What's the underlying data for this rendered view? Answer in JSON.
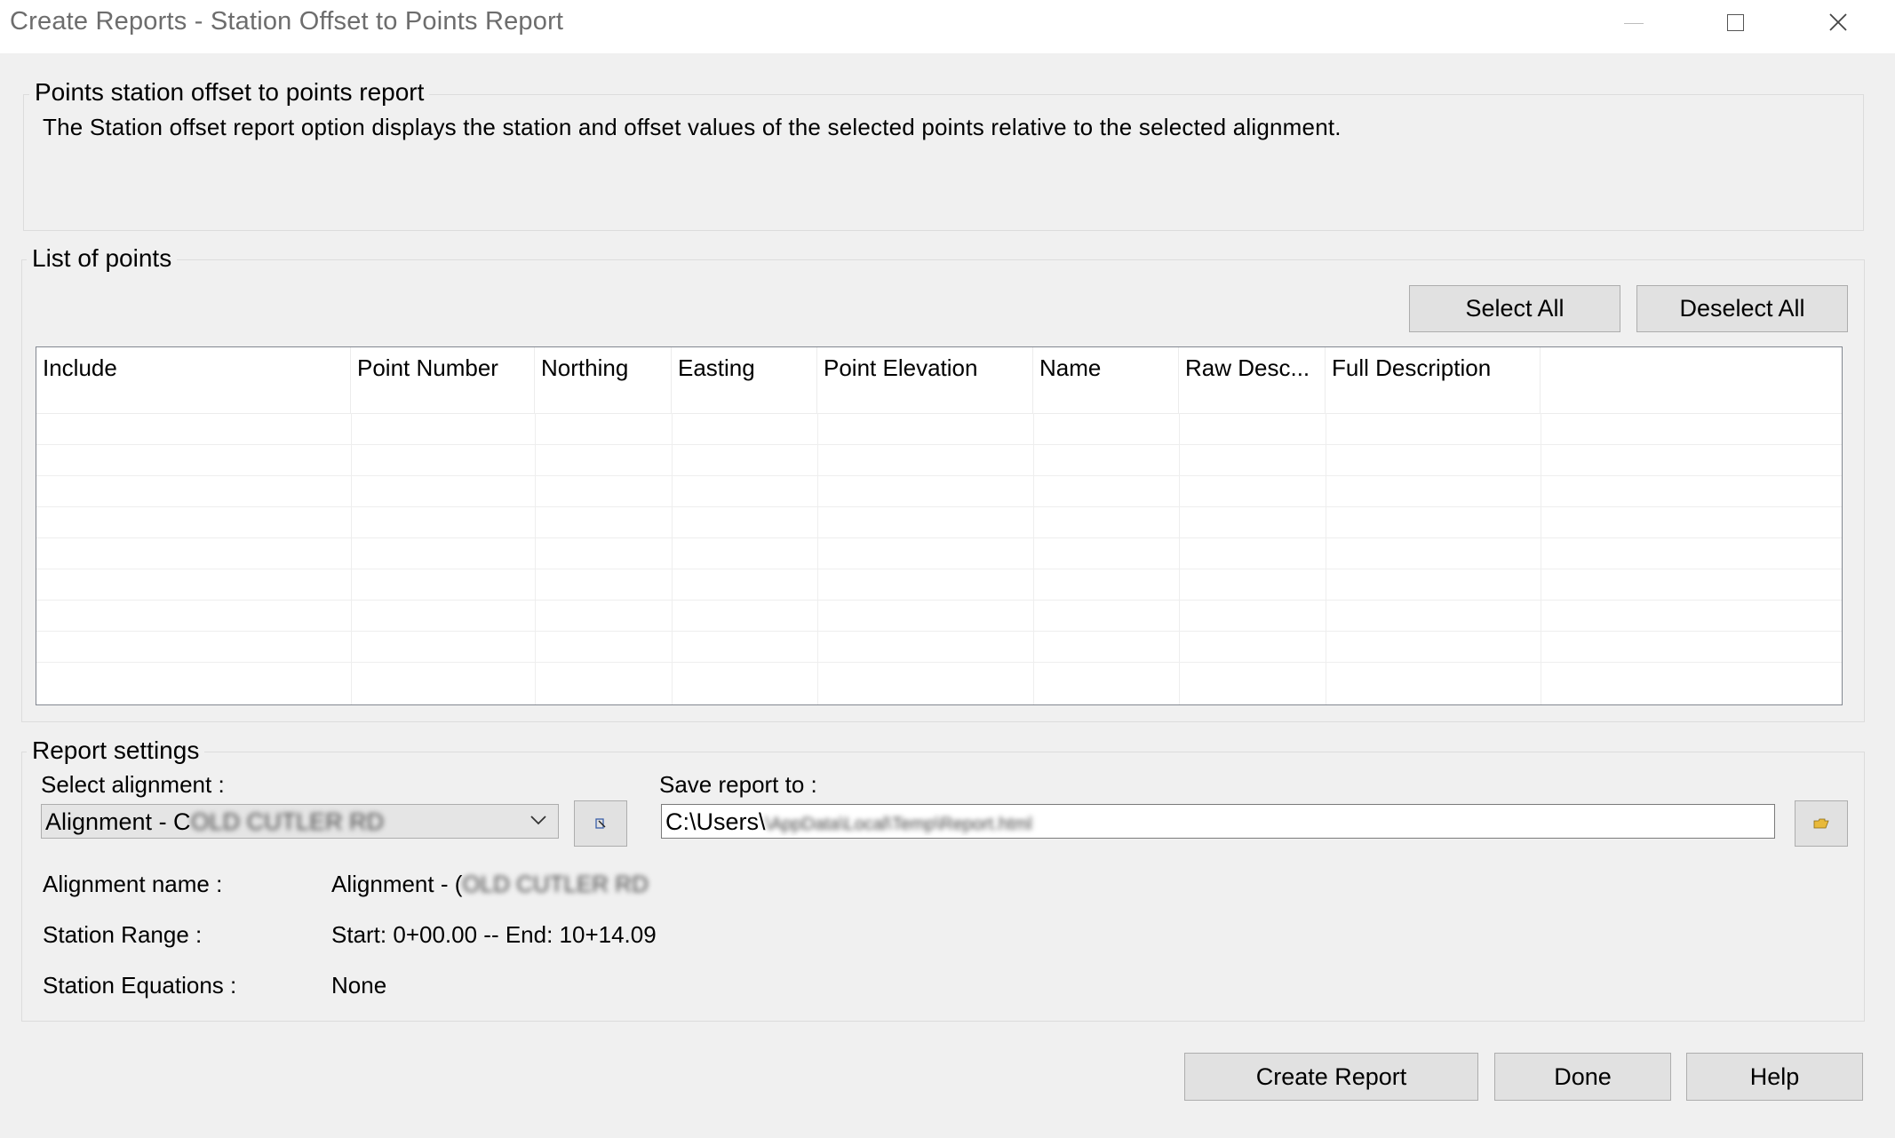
{
  "window": {
    "title": "Create Reports - Station Offset to Points Report"
  },
  "description_group": {
    "title": "Points station offset to points report",
    "text": "The Station offset report option displays the station and offset values of the selected points relative to the selected alignment."
  },
  "points_group": {
    "title": "List of points",
    "select_all_label": "Select All",
    "deselect_all_label": "Deselect All",
    "columns": [
      "Include",
      "Point Number",
      "Northing",
      "Easting",
      "Point Elevation",
      "Name",
      "Raw Desc...",
      "Full Description",
      ""
    ],
    "rows": []
  },
  "report_settings": {
    "title": "Report settings",
    "select_alignment_label": "Select alignment :",
    "selected_alignment_visible": "Alignment - C",
    "selected_alignment_obscured": "OLD CUTLER RD",
    "save_report_label": "Save report to :",
    "save_path_visible": "C:\\Users\\",
    "save_path_obscured": "\\AppData\\Local\\Temp\\Report.html",
    "alignment_name_label": "Alignment name :",
    "alignment_name_visible": "Alignment - (",
    "alignment_name_obscured": "OLD CUTLER RD",
    "station_range_label": "Station Range :",
    "station_range_value": "Start: 0+00.00 -- End: 10+14.09",
    "station_equations_label": "Station Equations :",
    "station_equations_value": "None"
  },
  "footer": {
    "create_report_label": "Create Report",
    "done_label": "Done",
    "help_label": "Help"
  },
  "icons": {
    "pick_alignment": "pick-from-drawing-icon",
    "browse_folder": "folder-browse-icon",
    "dropdown": "chevron-down-icon"
  }
}
